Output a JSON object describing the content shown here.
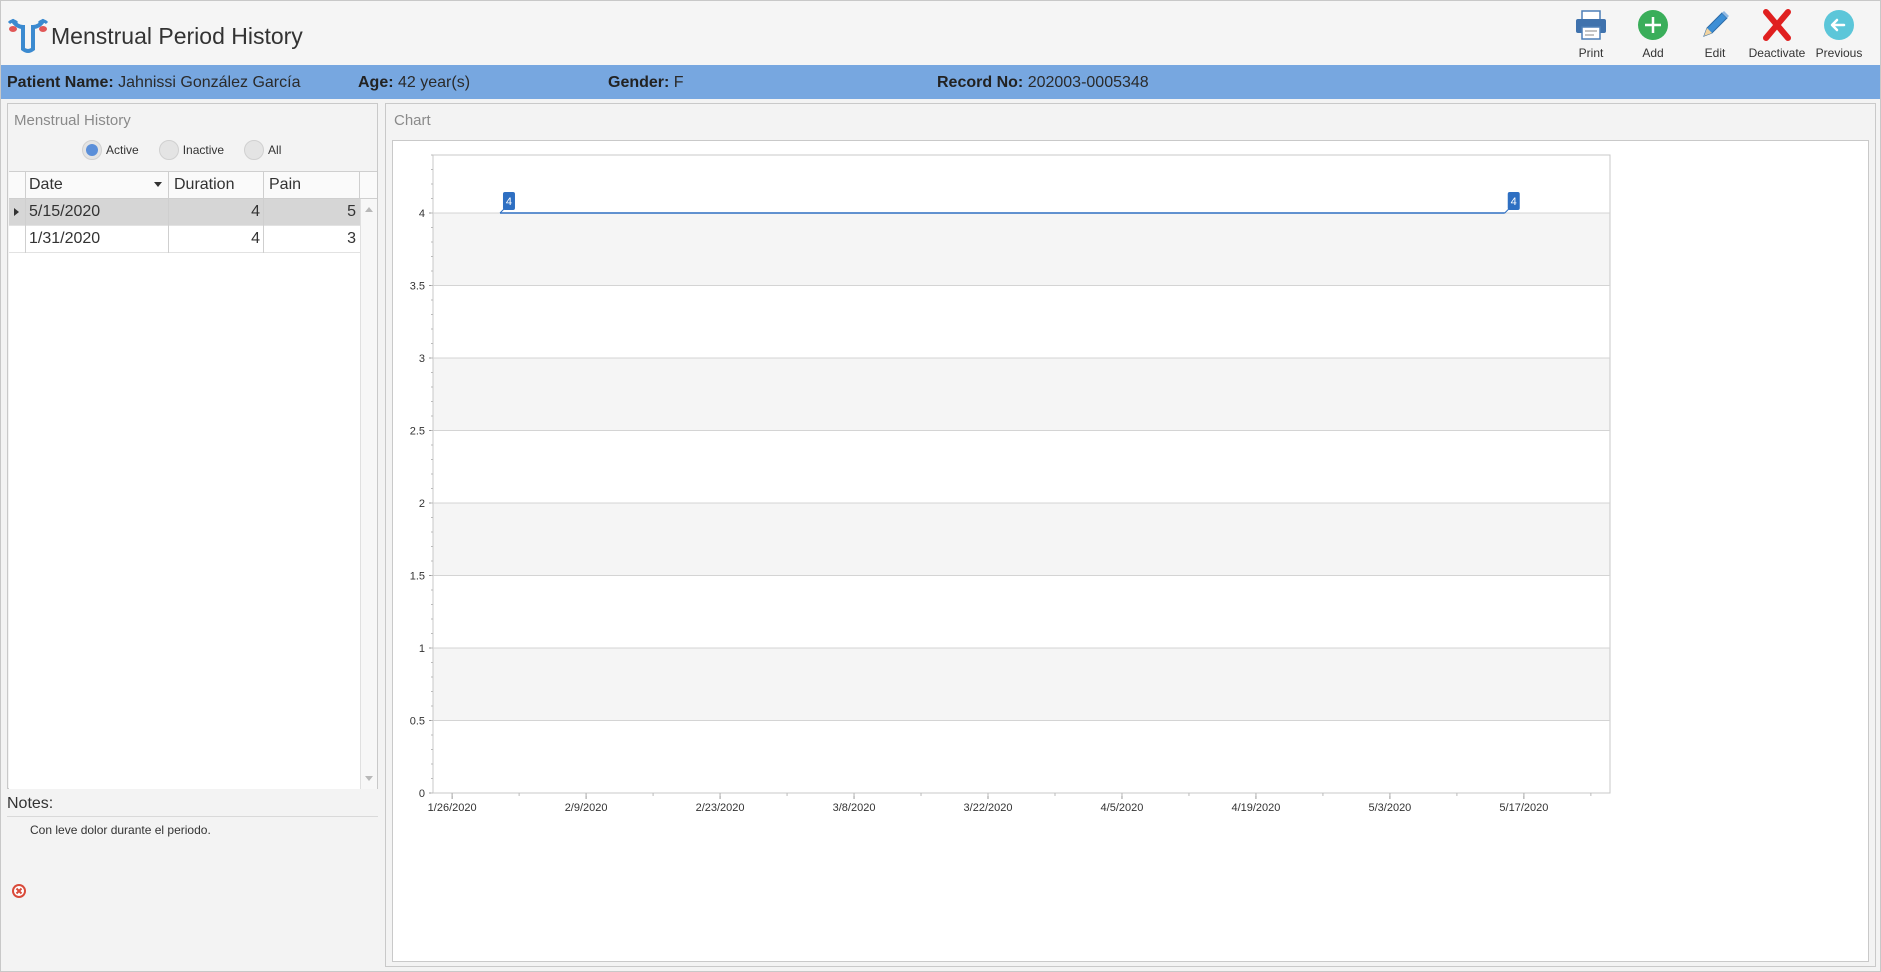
{
  "app": {
    "title": "Menstrual Period History"
  },
  "toolbar": {
    "print_label": "Print",
    "add_label": "Add",
    "edit_label": "Edit",
    "deactivate_label": "Deactivate",
    "previous_label": "Previous"
  },
  "patient": {
    "name_label": "Patient Name:",
    "name_value": "Jahnissi González García",
    "age_label": "Age:",
    "age_value": "42 year(s)",
    "gender_label": "Gender:",
    "gender_value": "F",
    "record_label": "Record No:",
    "record_value": "202003-0005348",
    "bar_color": "#77a7e0"
  },
  "history": {
    "title": "Menstrual History",
    "filters": [
      "Active",
      "Inactive",
      "All"
    ],
    "selected_filter": "Active",
    "columns": [
      "Date",
      "Duration",
      "Pain"
    ],
    "rows": [
      {
        "date": "5/15/2020",
        "duration": "4",
        "pain": "5"
      },
      {
        "date": "1/31/2020",
        "duration": "4",
        "pain": "3"
      }
    ]
  },
  "notes": {
    "label": "Notes:",
    "text": "Con leve dolor durante el periodo."
  },
  "chart_panel": {
    "title": "Chart"
  },
  "chart_data": {
    "type": "line",
    "x_tick_labels": [
      "1/26/2020",
      "2/9/2020",
      "2/23/2020",
      "3/8/2020",
      "3/22/2020",
      "4/5/2020",
      "4/19/2020",
      "5/3/2020",
      "5/17/2020"
    ],
    "y_tick_labels": [
      "0",
      "0.5",
      "1",
      "1.5",
      "2",
      "2.5",
      "3",
      "3.5",
      "4"
    ],
    "ylim": [
      0,
      4.4
    ],
    "xlim": [
      "2020-01-24",
      "2020-05-26"
    ],
    "series": [
      {
        "points": [
          {
            "x": "2020-01-31",
            "y": 4
          },
          {
            "x": "2020-05-15",
            "y": 4
          }
        ],
        "data_labels": [
          "4",
          "4"
        ],
        "color": "#2e6fc2"
      }
    ],
    "grid": true,
    "alternating_bands": true
  }
}
